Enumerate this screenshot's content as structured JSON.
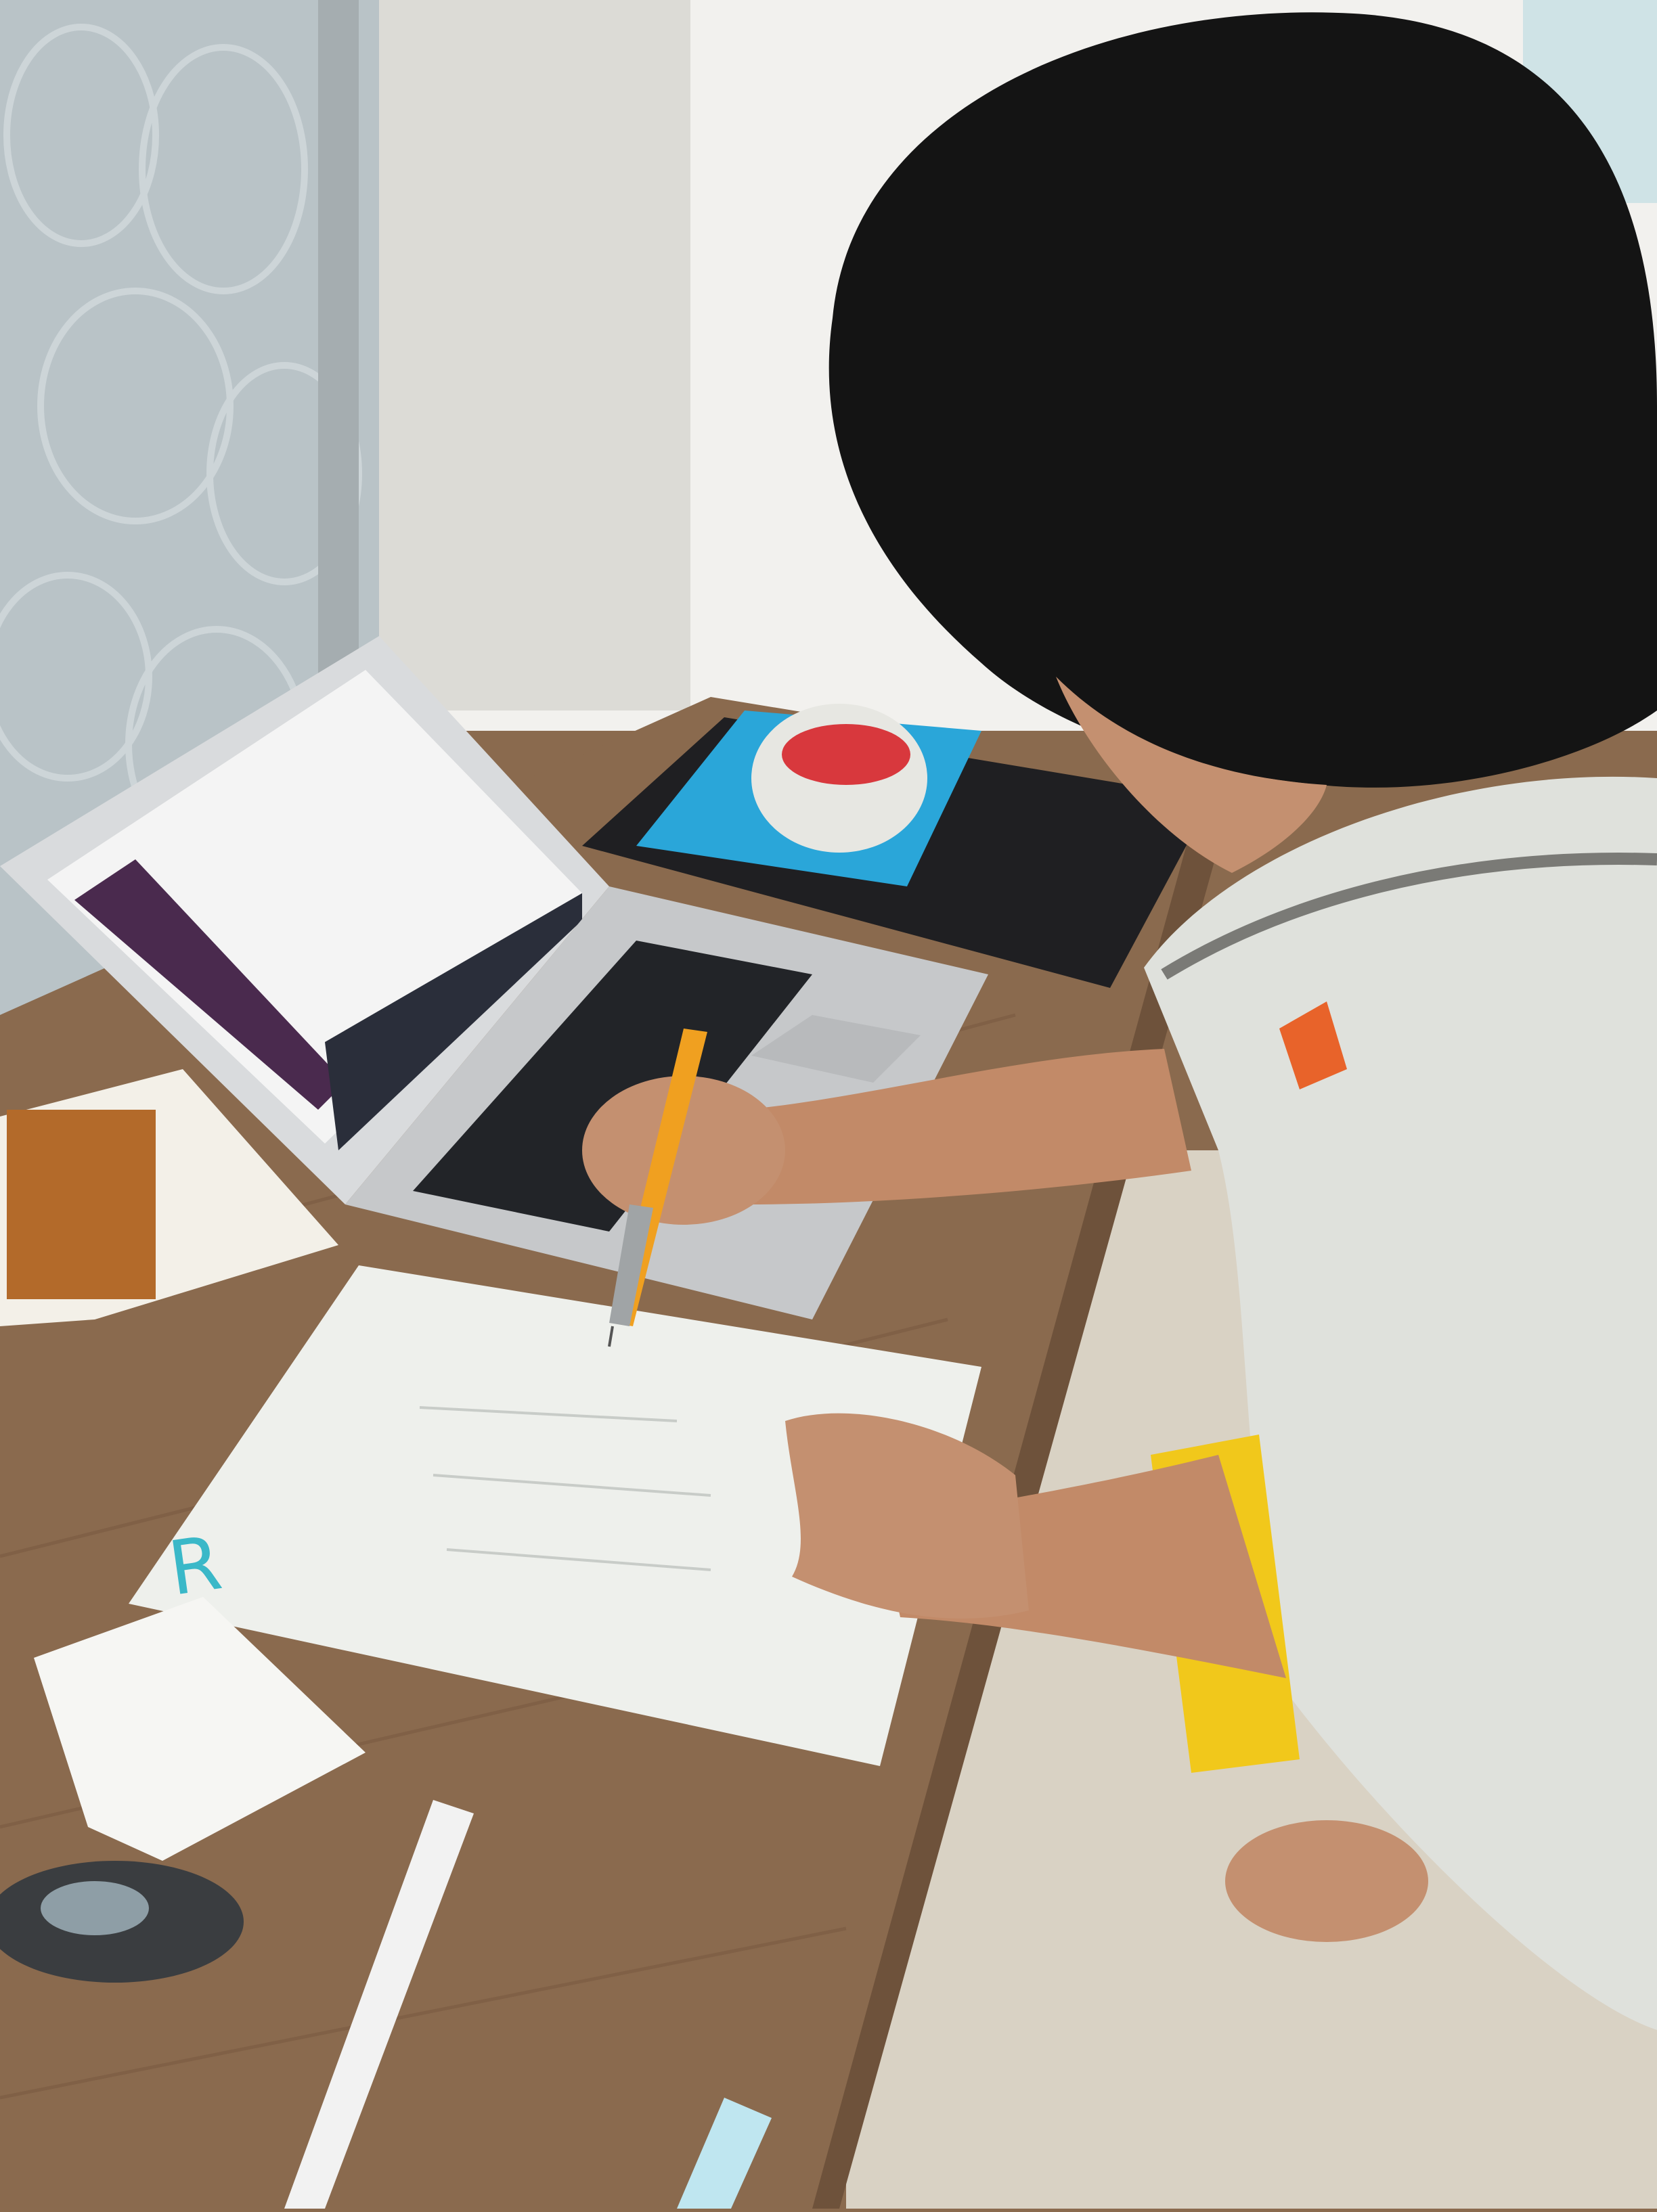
{
  "scene": {
    "description_tag": "photo",
    "colors": {
      "wall": "#b9c3c7",
      "desk": "#8a6a4e",
      "laptop": "#d9dbdd",
      "screen_sidebar": "#4a2a4e",
      "paper": "#eef0ec",
      "shirt": "#dfe1dc",
      "hair": "#141414",
      "tape_red": "#d8383d",
      "folder_blue": "#2aa6d9",
      "marker_teal": "#3ab8c8",
      "pencil_orange": "#f0a020",
      "floor": "#d9d2c4"
    }
  },
  "paper": {
    "handwritten_letter": "R"
  }
}
